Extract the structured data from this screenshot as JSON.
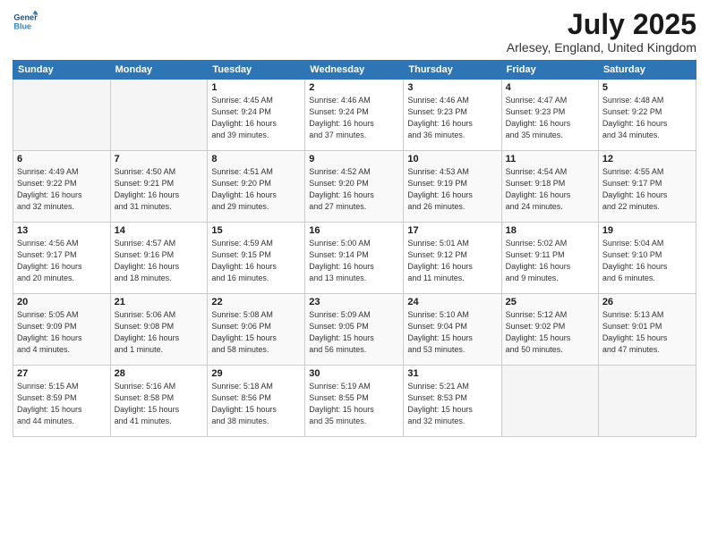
{
  "logo": {
    "line1": "General",
    "line2": "Blue"
  },
  "title": "July 2025",
  "location": "Arlesey, England, United Kingdom",
  "days_header": [
    "Sunday",
    "Monday",
    "Tuesday",
    "Wednesday",
    "Thursday",
    "Friday",
    "Saturday"
  ],
  "weeks": [
    [
      {
        "num": "",
        "info": ""
      },
      {
        "num": "",
        "info": ""
      },
      {
        "num": "1",
        "info": "Sunrise: 4:45 AM\nSunset: 9:24 PM\nDaylight: 16 hours\nand 39 minutes."
      },
      {
        "num": "2",
        "info": "Sunrise: 4:46 AM\nSunset: 9:24 PM\nDaylight: 16 hours\nand 37 minutes."
      },
      {
        "num": "3",
        "info": "Sunrise: 4:46 AM\nSunset: 9:23 PM\nDaylight: 16 hours\nand 36 minutes."
      },
      {
        "num": "4",
        "info": "Sunrise: 4:47 AM\nSunset: 9:23 PM\nDaylight: 16 hours\nand 35 minutes."
      },
      {
        "num": "5",
        "info": "Sunrise: 4:48 AM\nSunset: 9:22 PM\nDaylight: 16 hours\nand 34 minutes."
      }
    ],
    [
      {
        "num": "6",
        "info": "Sunrise: 4:49 AM\nSunset: 9:22 PM\nDaylight: 16 hours\nand 32 minutes."
      },
      {
        "num": "7",
        "info": "Sunrise: 4:50 AM\nSunset: 9:21 PM\nDaylight: 16 hours\nand 31 minutes."
      },
      {
        "num": "8",
        "info": "Sunrise: 4:51 AM\nSunset: 9:20 PM\nDaylight: 16 hours\nand 29 minutes."
      },
      {
        "num": "9",
        "info": "Sunrise: 4:52 AM\nSunset: 9:20 PM\nDaylight: 16 hours\nand 27 minutes."
      },
      {
        "num": "10",
        "info": "Sunrise: 4:53 AM\nSunset: 9:19 PM\nDaylight: 16 hours\nand 26 minutes."
      },
      {
        "num": "11",
        "info": "Sunrise: 4:54 AM\nSunset: 9:18 PM\nDaylight: 16 hours\nand 24 minutes."
      },
      {
        "num": "12",
        "info": "Sunrise: 4:55 AM\nSunset: 9:17 PM\nDaylight: 16 hours\nand 22 minutes."
      }
    ],
    [
      {
        "num": "13",
        "info": "Sunrise: 4:56 AM\nSunset: 9:17 PM\nDaylight: 16 hours\nand 20 minutes."
      },
      {
        "num": "14",
        "info": "Sunrise: 4:57 AM\nSunset: 9:16 PM\nDaylight: 16 hours\nand 18 minutes."
      },
      {
        "num": "15",
        "info": "Sunrise: 4:59 AM\nSunset: 9:15 PM\nDaylight: 16 hours\nand 16 minutes."
      },
      {
        "num": "16",
        "info": "Sunrise: 5:00 AM\nSunset: 9:14 PM\nDaylight: 16 hours\nand 13 minutes."
      },
      {
        "num": "17",
        "info": "Sunrise: 5:01 AM\nSunset: 9:12 PM\nDaylight: 16 hours\nand 11 minutes."
      },
      {
        "num": "18",
        "info": "Sunrise: 5:02 AM\nSunset: 9:11 PM\nDaylight: 16 hours\nand 9 minutes."
      },
      {
        "num": "19",
        "info": "Sunrise: 5:04 AM\nSunset: 9:10 PM\nDaylight: 16 hours\nand 6 minutes."
      }
    ],
    [
      {
        "num": "20",
        "info": "Sunrise: 5:05 AM\nSunset: 9:09 PM\nDaylight: 16 hours\nand 4 minutes."
      },
      {
        "num": "21",
        "info": "Sunrise: 5:06 AM\nSunset: 9:08 PM\nDaylight: 16 hours\nand 1 minute."
      },
      {
        "num": "22",
        "info": "Sunrise: 5:08 AM\nSunset: 9:06 PM\nDaylight: 15 hours\nand 58 minutes."
      },
      {
        "num": "23",
        "info": "Sunrise: 5:09 AM\nSunset: 9:05 PM\nDaylight: 15 hours\nand 56 minutes."
      },
      {
        "num": "24",
        "info": "Sunrise: 5:10 AM\nSunset: 9:04 PM\nDaylight: 15 hours\nand 53 minutes."
      },
      {
        "num": "25",
        "info": "Sunrise: 5:12 AM\nSunset: 9:02 PM\nDaylight: 15 hours\nand 50 minutes."
      },
      {
        "num": "26",
        "info": "Sunrise: 5:13 AM\nSunset: 9:01 PM\nDaylight: 15 hours\nand 47 minutes."
      }
    ],
    [
      {
        "num": "27",
        "info": "Sunrise: 5:15 AM\nSunset: 8:59 PM\nDaylight: 15 hours\nand 44 minutes."
      },
      {
        "num": "28",
        "info": "Sunrise: 5:16 AM\nSunset: 8:58 PM\nDaylight: 15 hours\nand 41 minutes."
      },
      {
        "num": "29",
        "info": "Sunrise: 5:18 AM\nSunset: 8:56 PM\nDaylight: 15 hours\nand 38 minutes."
      },
      {
        "num": "30",
        "info": "Sunrise: 5:19 AM\nSunset: 8:55 PM\nDaylight: 15 hours\nand 35 minutes."
      },
      {
        "num": "31",
        "info": "Sunrise: 5:21 AM\nSunset: 8:53 PM\nDaylight: 15 hours\nand 32 minutes."
      },
      {
        "num": "",
        "info": ""
      },
      {
        "num": "",
        "info": ""
      }
    ]
  ]
}
